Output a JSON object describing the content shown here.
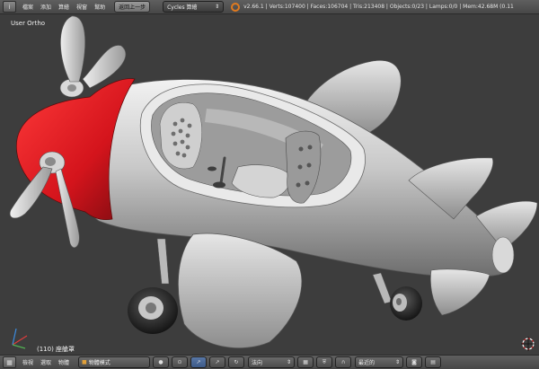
{
  "header": {
    "editor_icon": "info-editor-icon",
    "menu": [
      "檔案",
      "添加",
      "算繪",
      "視窗",
      "幫助"
    ],
    "back_button": "返回上一步",
    "render_engine": "Cycles 算繪",
    "stats": "v2.66.1 | Verts:107400 | Faces:106704 | Tris:213408 | Objects:0/23 | Lamps:0/0 | Mem:42.68M (0.11"
  },
  "viewport": {
    "view_label": "User Ortho",
    "object_label": "(110) 座艙罩",
    "colors": {
      "background": "#3d3d3d",
      "body": "#c4c4c4",
      "nose": "#e5202a",
      "shadow": "#6f6f6f"
    }
  },
  "footer": {
    "menu": [
      "檢視",
      "選取",
      "物體"
    ],
    "mode": "物體模式",
    "orientation": "法向",
    "snap": "最近的"
  }
}
